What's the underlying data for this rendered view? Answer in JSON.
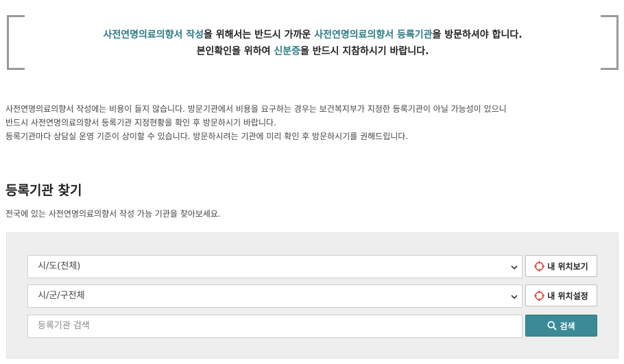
{
  "notice": {
    "line1": {
      "a": "사전연명의료의향서 작성",
      "b": "을 위해서는 반드시 가까운 ",
      "c": "사전연명의료의향서 등록기관",
      "d": "을 방문하셔야 합니다."
    },
    "line2": {
      "a": "본인확인을 위하여 ",
      "b": "신분증",
      "c": "을 반드시 지참하시기 바랍니다."
    }
  },
  "info": {
    "lines": [
      "사전연명의료의향서 작성에는 비용이 들지 않습니다. 방문기관에서 비용을 요구하는 경우는 보건복지부가 지정한 등록기관이 아닐 가능성이 있으니",
      "반드시 사전연명의료의향서 등록기관 지정현황을 확인 후 방문하시기 바랍니다.",
      "등록기관마다 상담실 운영 기준이 상이할 수 있습니다. 방문하시려는 기관에 미리 확인 후 방문하시기를 권해드립니다."
    ]
  },
  "section": {
    "title": "등록기관 찾기",
    "desc": "전국에 있는 사전연명의료의향서 작성 가능 기관을 찾아보세요."
  },
  "search": {
    "region_select": "시/도(전체)",
    "district_select": "시/군/구전체",
    "keyword_placeholder": "등록기관 검색",
    "my_location_button": "내 위치보기",
    "set_location_button": "내 위치설정",
    "search_button": "검색"
  },
  "colors": {
    "highlight": "#2c7c84",
    "search_button_bg": "#3b8a96",
    "location_icon": "#e2432f"
  }
}
